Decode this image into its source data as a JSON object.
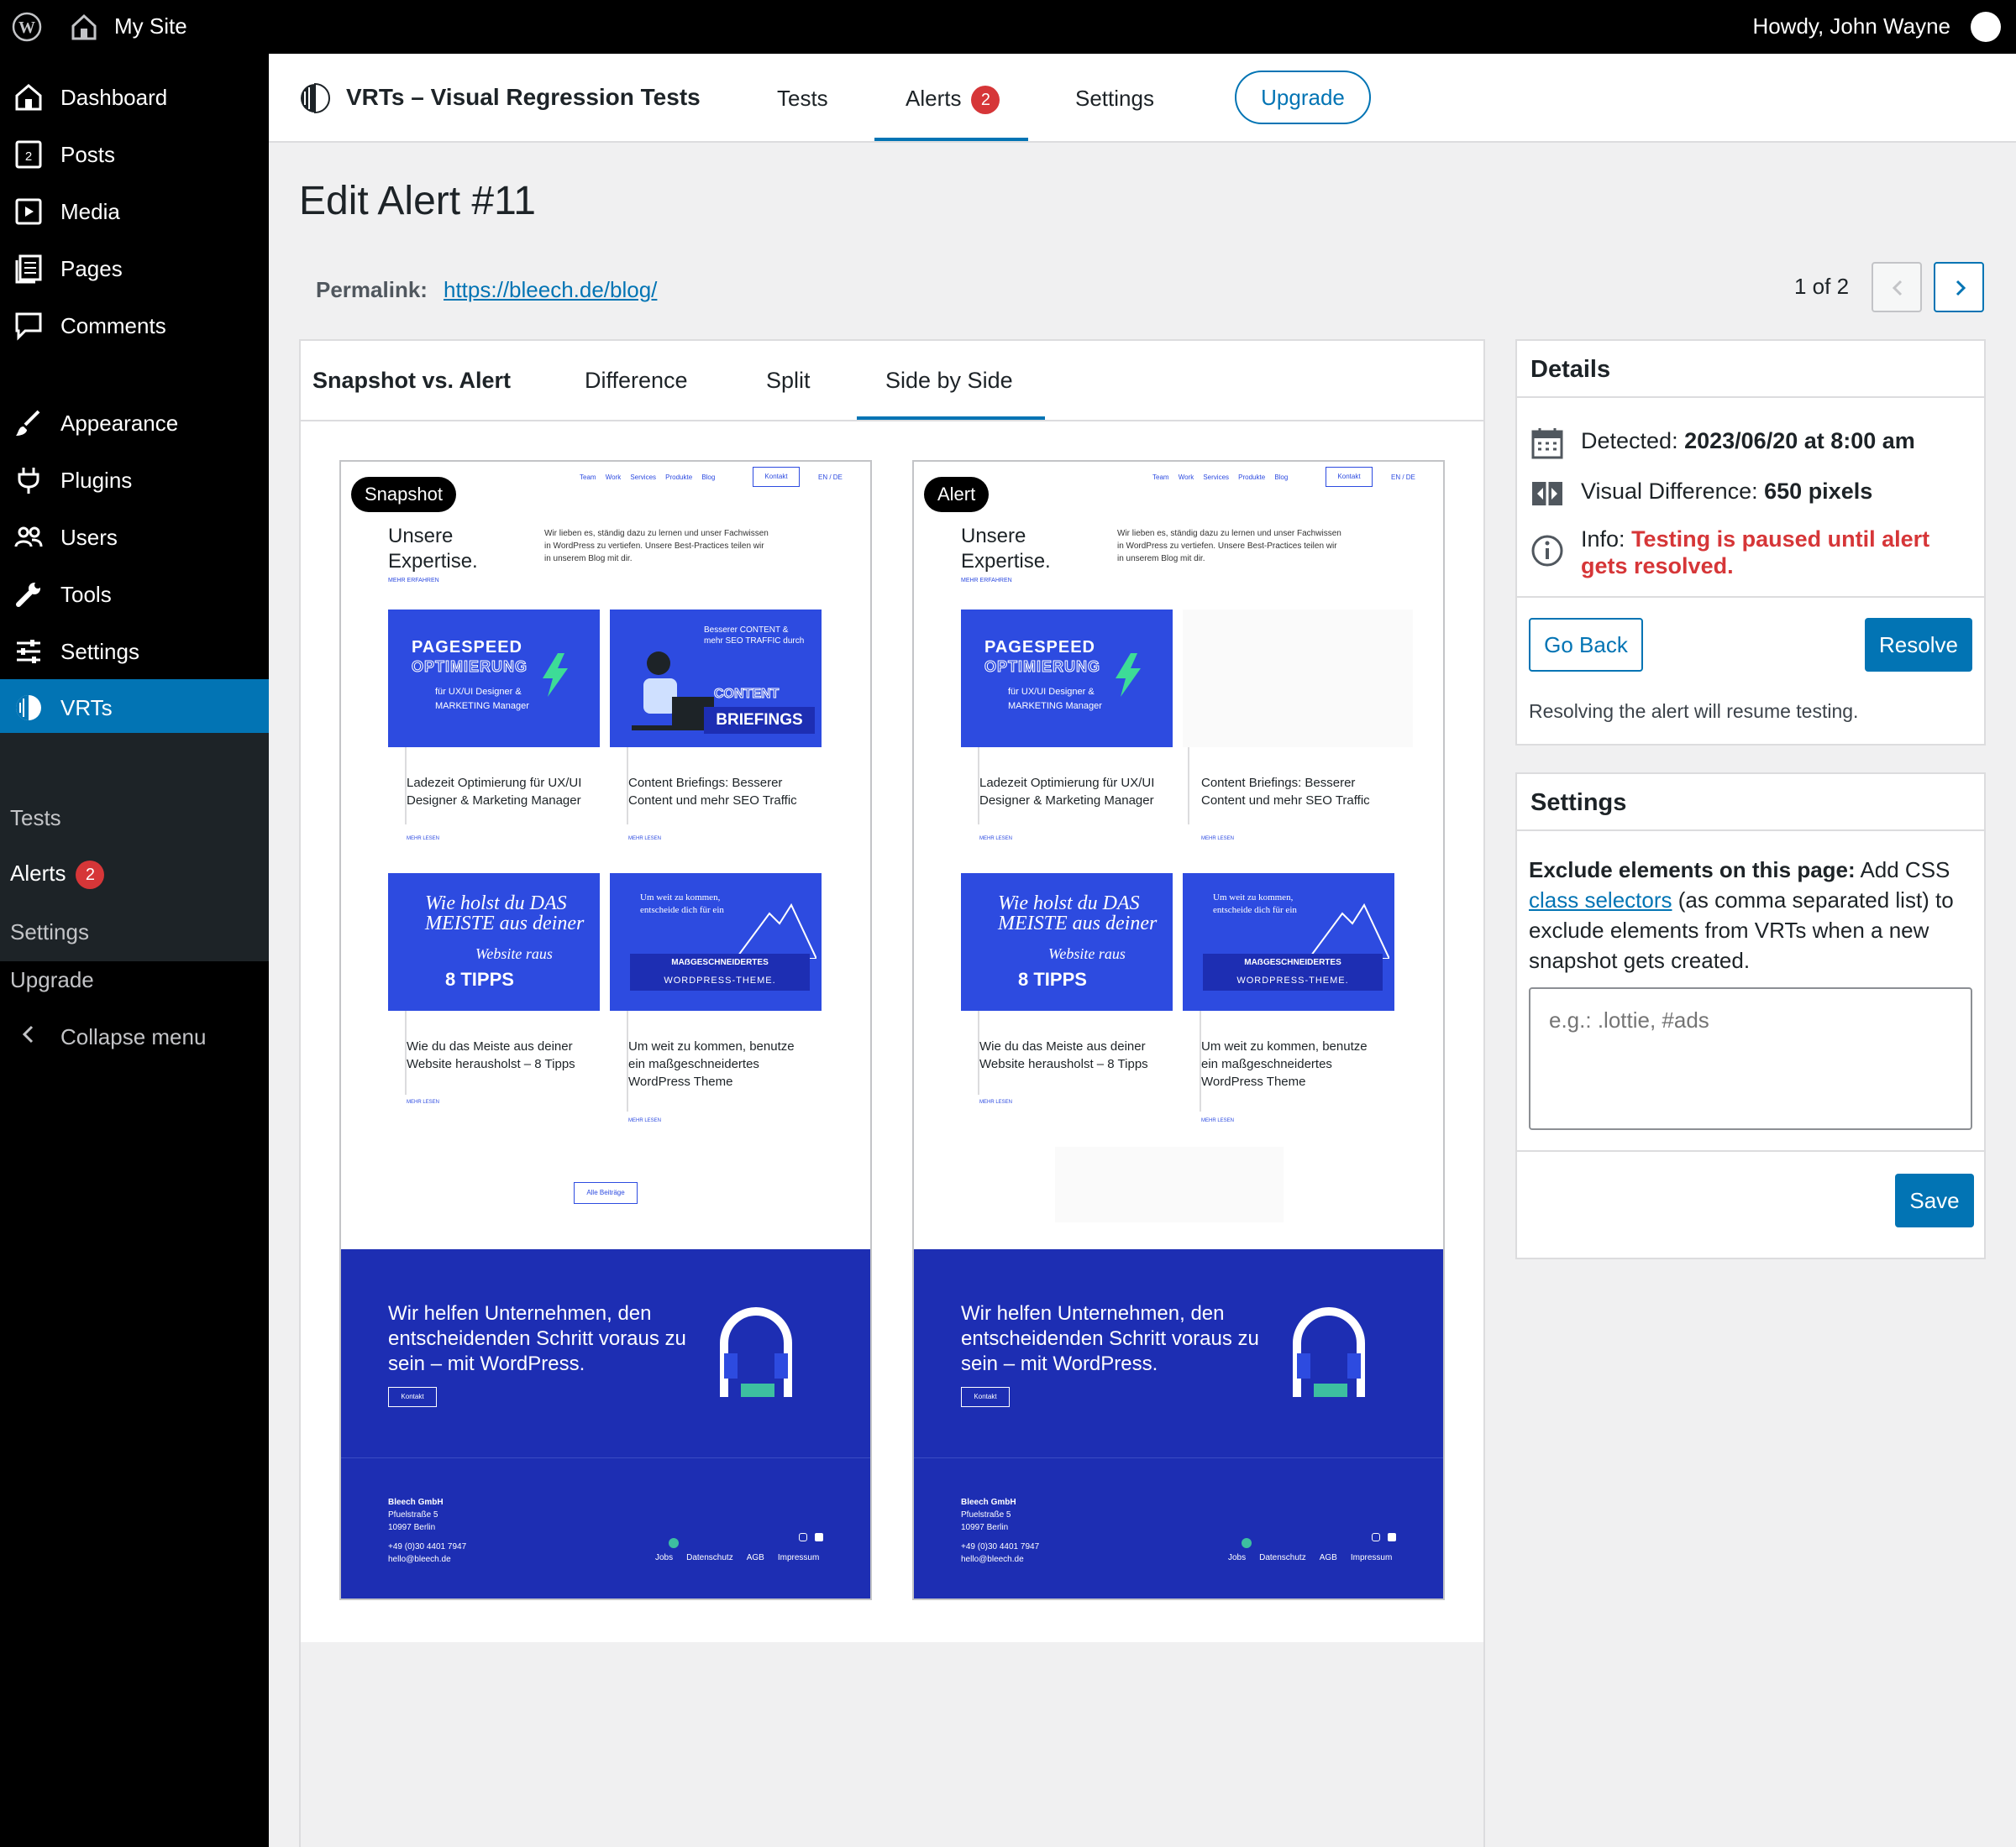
{
  "admin_bar": {
    "site_name": "My Site",
    "greeting": "Howdy, John Wayne"
  },
  "sidebar": {
    "items": [
      {
        "label": "Dashboard",
        "icon": "dashboard-icon"
      },
      {
        "label": "Posts",
        "icon": "posts-icon"
      },
      {
        "label": "Media",
        "icon": "media-icon"
      },
      {
        "label": "Pages",
        "icon": "pages-icon"
      },
      {
        "label": "Comments",
        "icon": "comments-icon"
      },
      {
        "label": "Appearance",
        "icon": "appearance-icon"
      },
      {
        "label": "Plugins",
        "icon": "plugins-icon"
      },
      {
        "label": "Users",
        "icon": "users-icon"
      },
      {
        "label": "Tools",
        "icon": "tools-icon"
      },
      {
        "label": "Settings",
        "icon": "settings-icon"
      },
      {
        "label": "VRTs",
        "icon": "vrts-icon"
      }
    ],
    "posts_icon_number": "2",
    "submenu": [
      {
        "label": "Tests"
      },
      {
        "label": "Alerts",
        "badge": "2"
      },
      {
        "label": "Settings"
      },
      {
        "label": "Upgrade"
      }
    ],
    "collapse_label": "Collapse menu"
  },
  "plugin_header": {
    "title": "VRTs – Visual Regression Tests",
    "tabs": [
      {
        "label": "Tests"
      },
      {
        "label": "Alerts",
        "badge": "2"
      },
      {
        "label": "Settings"
      }
    ],
    "upgrade_label": "Upgrade"
  },
  "page": {
    "title": "Edit Alert #11",
    "permalink_label": "Permalink:",
    "permalink_url": "https://bleech.de/blog/",
    "pager": "1 of 2"
  },
  "compare": {
    "tabs": [
      "Snapshot vs. Alert",
      "Difference",
      "Split",
      "Side by Side"
    ],
    "active_tab": "Side by Side",
    "snapshot_label": "Snapshot",
    "alert_label": "Alert"
  },
  "preview": {
    "nav": [
      "Team",
      "Work",
      "Services",
      "Produkte",
      "Blog"
    ],
    "kontakt": "Kontakt",
    "lang": "EN / DE",
    "heading_1": "Unsere",
    "heading_2": "Expertise.",
    "intro": "Wir lieben es, ständig dazu zu lernen und unser Fachwissen in WordPress zu vertiefen. Unsere Best-Practices teilen wir in unserem Blog mit dir.",
    "more_link": "MEHR ERFAHREN",
    "read_more": "MEHR LESEN",
    "cards": [
      {
        "title": "Ladezeit Optimierung für UX/UI Designer & Marketing Manager",
        "art_1": "PAGESPEED",
        "art_2": "OPTIMIERUNG",
        "art_3": "für UX/UI Designer & MARKETING Manager"
      },
      {
        "title": "Content Briefings: Besserer Content und mehr SEO Traffic",
        "art_1": "Besserer CONTENT & mehr SEO TRAFFIC durch",
        "art_2": "CONTENT",
        "art_3": "BRIEFINGS"
      },
      {
        "title": "Wie du das Meiste aus deiner Website herausholst – 8 Tipps",
        "art_1": "Wie holst du DAS MEISTE aus deiner",
        "art_2": "Website raus",
        "art_3": "8 TIPPS"
      },
      {
        "title": "Um weit zu kommen, benutze ein maßgeschneidertes WordPress Theme",
        "art_1": "Um weit zu kommen, entscheide dich für ein",
        "art_2": "MAẞGESCHNEIDERTES",
        "art_3": "WORDPRESS-THEME."
      }
    ],
    "all_posts": "Alle Beiträge",
    "slogan": "Wir helfen Unternehmen, den entscheidenden Schritt voraus zu sein – mit WordPress.",
    "slogan_button": "Kontakt",
    "company": "Bleech GmbH",
    "street": "Pfuelstraße 5",
    "city": "10997 Berlin",
    "phone": "+49 (0)30 4401 7947",
    "email": "hello@bleech.de",
    "footer_links": [
      "Jobs",
      "Datenschutz",
      "AGB",
      "Impressum"
    ]
  },
  "details": {
    "title": "Details",
    "detected_label": "Detected:",
    "detected_value": "2023/06/20 at 8:00 am",
    "visual_diff_label": "Visual Difference:",
    "visual_diff_value": "650 pixels",
    "info_label": "Info:",
    "info_value_1": "Testing is paused until alert",
    "info_value_2": "gets resolved.",
    "go_back": "Go Back",
    "resolve": "Resolve",
    "resolve_note": "Resolving the alert will resume testing."
  },
  "settings_panel": {
    "title": "Settings",
    "bold": "Exclude elements on this page:",
    "text_1": " Add CSS",
    "link": "class selectors",
    "text_2": " (as comma separated list) to exclude elements from VRTs when a new snapshot gets created.",
    "placeholder": "e.g.: .lottie, #ads",
    "save": "Save"
  },
  "colors": {
    "accent": "#0274b4",
    "badge": "#d63638",
    "preview_blue": "#2d4be0",
    "footer_blue": "#1d2eb3"
  }
}
